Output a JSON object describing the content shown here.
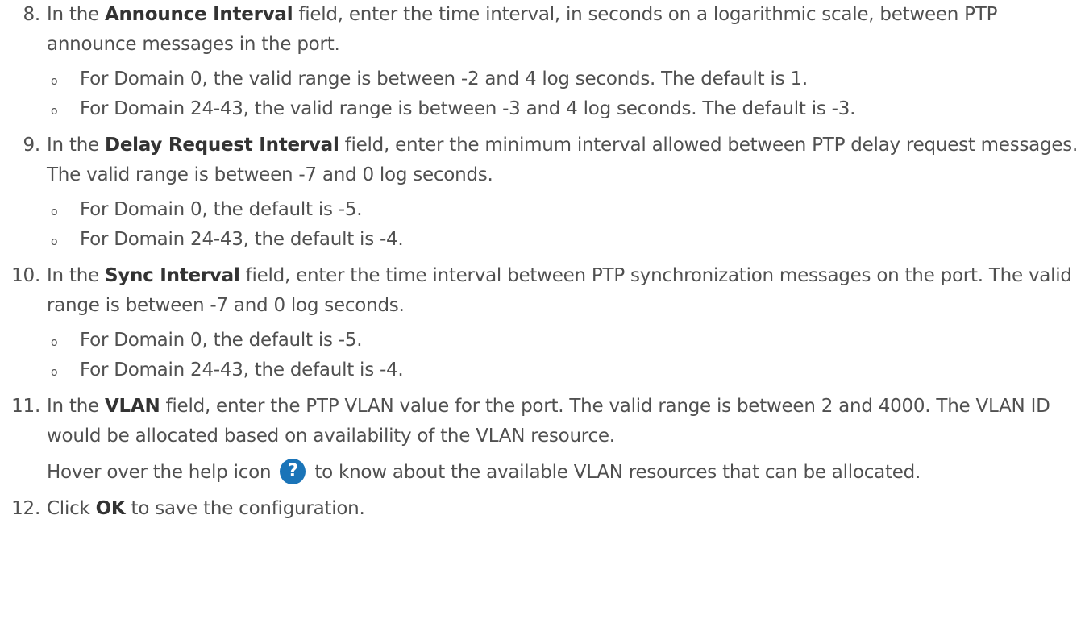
{
  "steps": [
    {
      "number": "8.",
      "pre": "In the ",
      "bold": "Announce Interval",
      "post": " field, enter the time interval, in seconds on a logarithmic scale, between PTP announce messages in the port.",
      "bullets": [
        "For Domain 0, the valid range is between -2 and 4 log seconds. The default is 1.",
        "For Domain 24-43, the valid range is between -3 and 4 log seconds. The default is -3."
      ]
    },
    {
      "number": "9.",
      "pre": "In the ",
      "bold": "Delay Request Interval",
      "post": " field, enter the minimum interval allowed between PTP delay request messages. The valid range is between -7 and 0 log seconds.",
      "bullets": [
        "For Domain 0, the default is -5.",
        "For Domain 24-43, the default is -4."
      ]
    },
    {
      "number": "10.",
      "pre": "In the ",
      "bold": "Sync Interval",
      "post": " field, enter the time interval between PTP synchronization messages on the port. The valid range is between -7 and 0 log seconds.",
      "bullets": [
        "For Domain 0, the default is -5.",
        "For Domain 24-43, the default is -4."
      ]
    },
    {
      "number": "11.",
      "pre": "In the ",
      "bold": "VLAN",
      "post": " field, enter the PTP VLAN value for the port. The valid range is between 2 and 4000. The VLAN ID would be allocated based on availability of the VLAN resource.",
      "note_pre": "Hover over the help icon ",
      "note_icon": "help-icon",
      "note_icon_glyph": "?",
      "note_post": " to know about the available VLAN resources that can be allocated."
    },
    {
      "number": "12.",
      "pre": "Click ",
      "bold": "OK",
      "post": " to save the configuration."
    }
  ],
  "bullet_glyph": "o",
  "colors": {
    "text": "#505050",
    "bold_text": "#333333",
    "help_icon_bg": "#1a74b8",
    "background": "#ffffff"
  }
}
